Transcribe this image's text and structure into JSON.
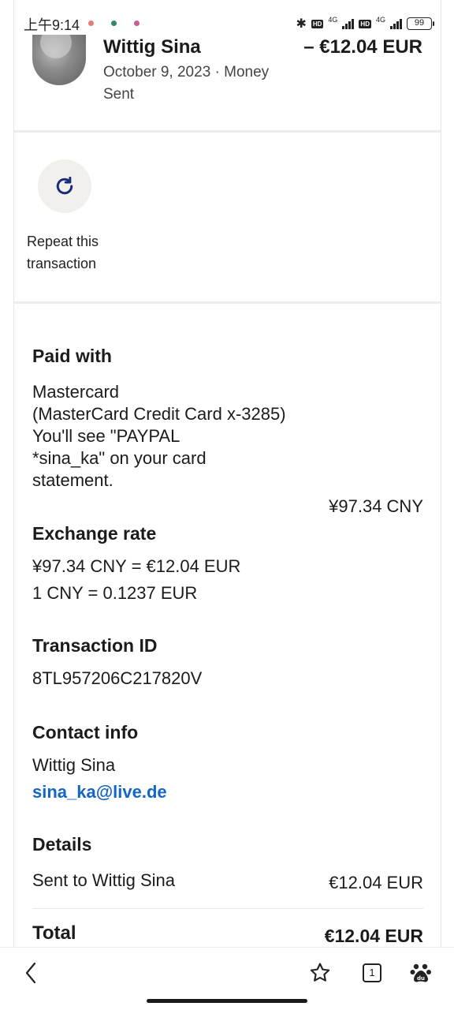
{
  "status_bar": {
    "time": "上午9:14",
    "network_1": "4G",
    "network_2": "4G",
    "hd_1": "HD",
    "hd_2": "HD",
    "battery": "99",
    "dot_colors": [
      "#e87a7a",
      "#2f8a6f",
      "#c85a9a"
    ]
  },
  "transaction": {
    "name": "Wittig Sina",
    "amount": "– €12.04 EUR",
    "date_type": "October 9, 2023 · Money Sent"
  },
  "repeat": {
    "label": "Repeat this transaction",
    "icon": "refresh-icon",
    "icon_color": "#1b2d7a"
  },
  "paid_with": {
    "heading": "Paid with",
    "line1": "Mastercard",
    "line2": "(MasterCard Credit Card x-3285)",
    "line3": "You'll see \"PAYPAL",
    "line4": "*sina_ka\" on your card",
    "line5": "statement.",
    "amount": "¥97.34 CNY"
  },
  "exchange": {
    "heading": "Exchange rate",
    "line1": "¥97.34 CNY = €12.04 EUR",
    "line2": "1 CNY = 0.1237 EUR"
  },
  "transaction_id": {
    "heading": "Transaction ID",
    "value": "8TL957206C217820V"
  },
  "contact": {
    "heading": "Contact info",
    "name": "Wittig Sina",
    "email": "sina_ka@live.de",
    "link_color": "#1466c4"
  },
  "details": {
    "heading": "Details",
    "row_label": "Sent to Wittig Sina",
    "row_amount": "€12.04 EUR"
  },
  "total": {
    "label": "Total",
    "amount": "€12.04 EUR"
  },
  "bottom_nav": {
    "tabs_count": "1",
    "icons": [
      "back-icon",
      "star-icon",
      "tabs-icon",
      "baidu-paw-icon"
    ]
  }
}
